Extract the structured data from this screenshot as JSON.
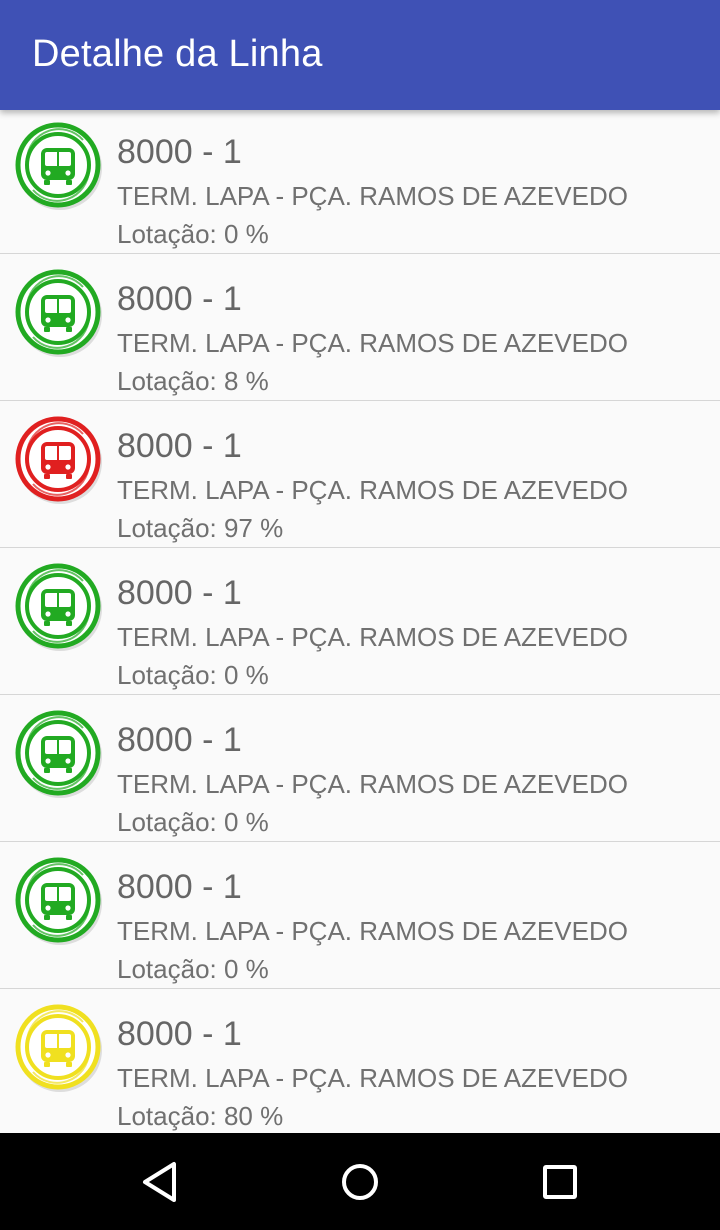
{
  "appbar": {
    "title": "Detalhe da Linha",
    "color": "#3f51b5"
  },
  "status_colors": {
    "low": "#22aa22",
    "high": "#e02020",
    "medium": "#f0e020"
  },
  "buses": [
    {
      "title": "8000 - 1",
      "route": "TERM. LAPA - PÇA. RAMOS DE AZEVEDO",
      "occupancy": "Lotação: 0 %",
      "status": "low"
    },
    {
      "title": "8000 - 1",
      "route": "TERM. LAPA - PÇA. RAMOS DE AZEVEDO",
      "occupancy": "Lotação: 8 %",
      "status": "low"
    },
    {
      "title": "8000 - 1",
      "route": "TERM. LAPA - PÇA. RAMOS DE AZEVEDO",
      "occupancy": "Lotação: 97 %",
      "status": "high"
    },
    {
      "title": "8000 - 1",
      "route": "TERM. LAPA - PÇA. RAMOS DE AZEVEDO",
      "occupancy": "Lotação: 0 %",
      "status": "low"
    },
    {
      "title": "8000 - 1",
      "route": "TERM. LAPA - PÇA. RAMOS DE AZEVEDO",
      "occupancy": "Lotação: 0 %",
      "status": "low"
    },
    {
      "title": "8000 - 1",
      "route": "TERM. LAPA - PÇA. RAMOS DE AZEVEDO",
      "occupancy": "Lotação: 0 %",
      "status": "low"
    },
    {
      "title": "8000 - 1",
      "route": "TERM. LAPA - PÇA. RAMOS DE AZEVEDO",
      "occupancy": "Lotação: 80 %",
      "status": "medium"
    }
  ],
  "navbar": {
    "back_icon": "back-triangle-icon",
    "home_icon": "home-circle-icon",
    "recents_icon": "recents-square-icon"
  }
}
